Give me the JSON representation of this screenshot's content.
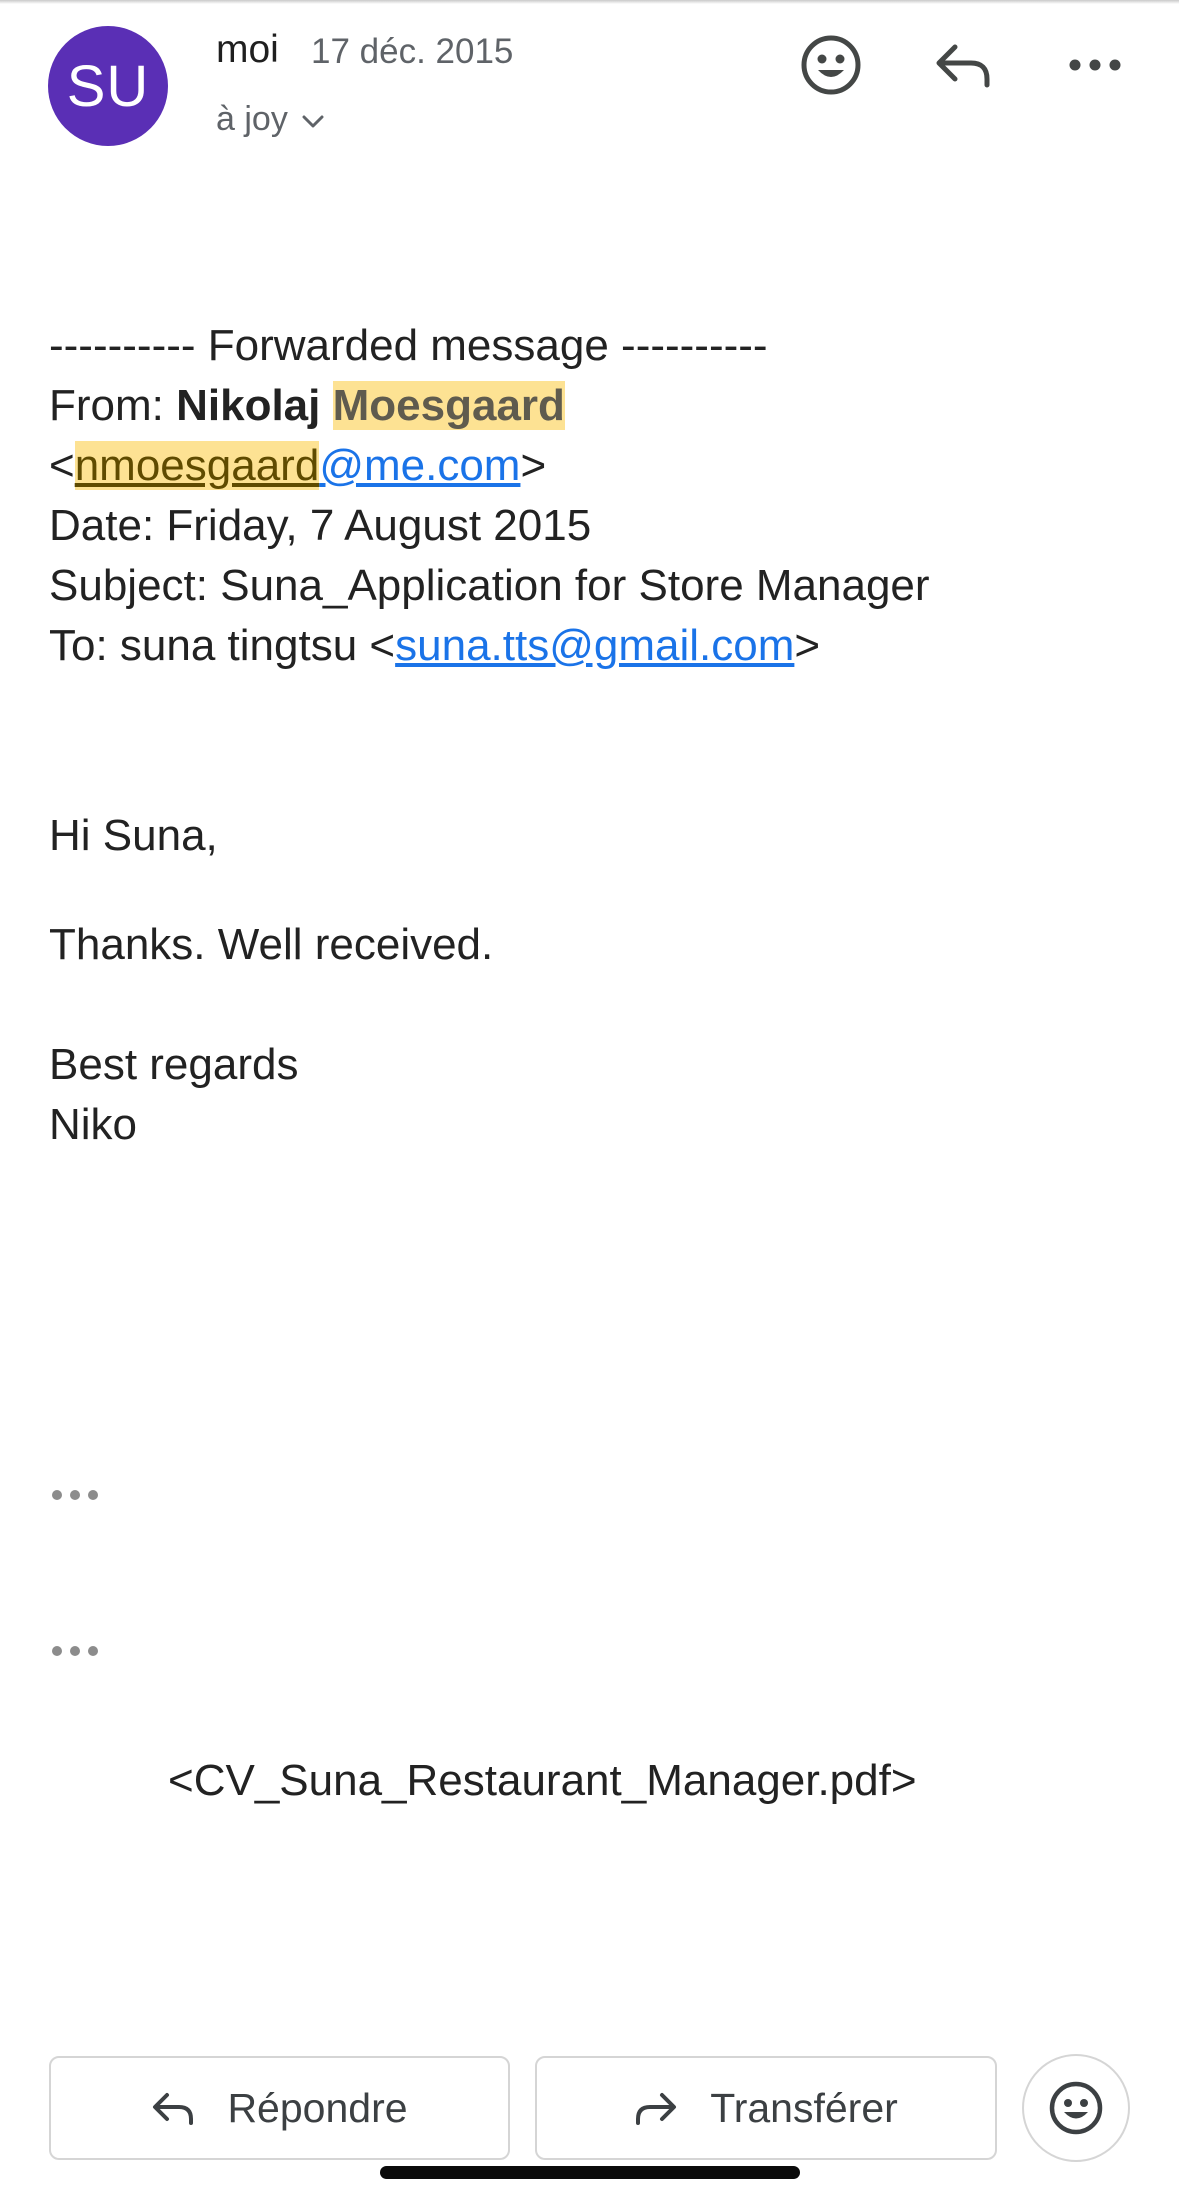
{
  "header": {
    "avatar_initials": "SU",
    "avatar_color": "#5a2fb5",
    "sender": "moi",
    "date": "17 déc. 2015",
    "recipient": "à joy",
    "icons": [
      "emoji-reaction-icon",
      "reply-icon",
      "more-options-icon",
      "chevron-down-icon"
    ]
  },
  "message": {
    "forward_header": "---------- Forwarded message ----------",
    "from_label": "From: ",
    "from_first_name": "Nikolaj",
    "from_last_name": "Moesgaard",
    "from_email_open": "<",
    "from_email_user": "nmoesgaard",
    "from_email_domain": "@me.com",
    "from_email_close": ">",
    "date_line": "Date: Friday, 7 August 2015",
    "subject_label": "Subject: ",
    "subject_value": "Suna_Application for Store Manager",
    "to_label": "To:  suna tingtsu <",
    "to_email": "suna.tts@gmail.com",
    "to_close": ">",
    "greeting": "Hi Suna,",
    "body_line": "Thanks. Well received.",
    "closing": "Best regards",
    "signature": "Niko"
  },
  "attachment": {
    "filename": "<CV_Suna_Restaurant_Manager.pdf>"
  },
  "actions": {
    "reply_label": "Répondre",
    "forward_label": "Transférer"
  },
  "colors": {
    "highlight": "#fde293",
    "link": "#1a73e8"
  }
}
